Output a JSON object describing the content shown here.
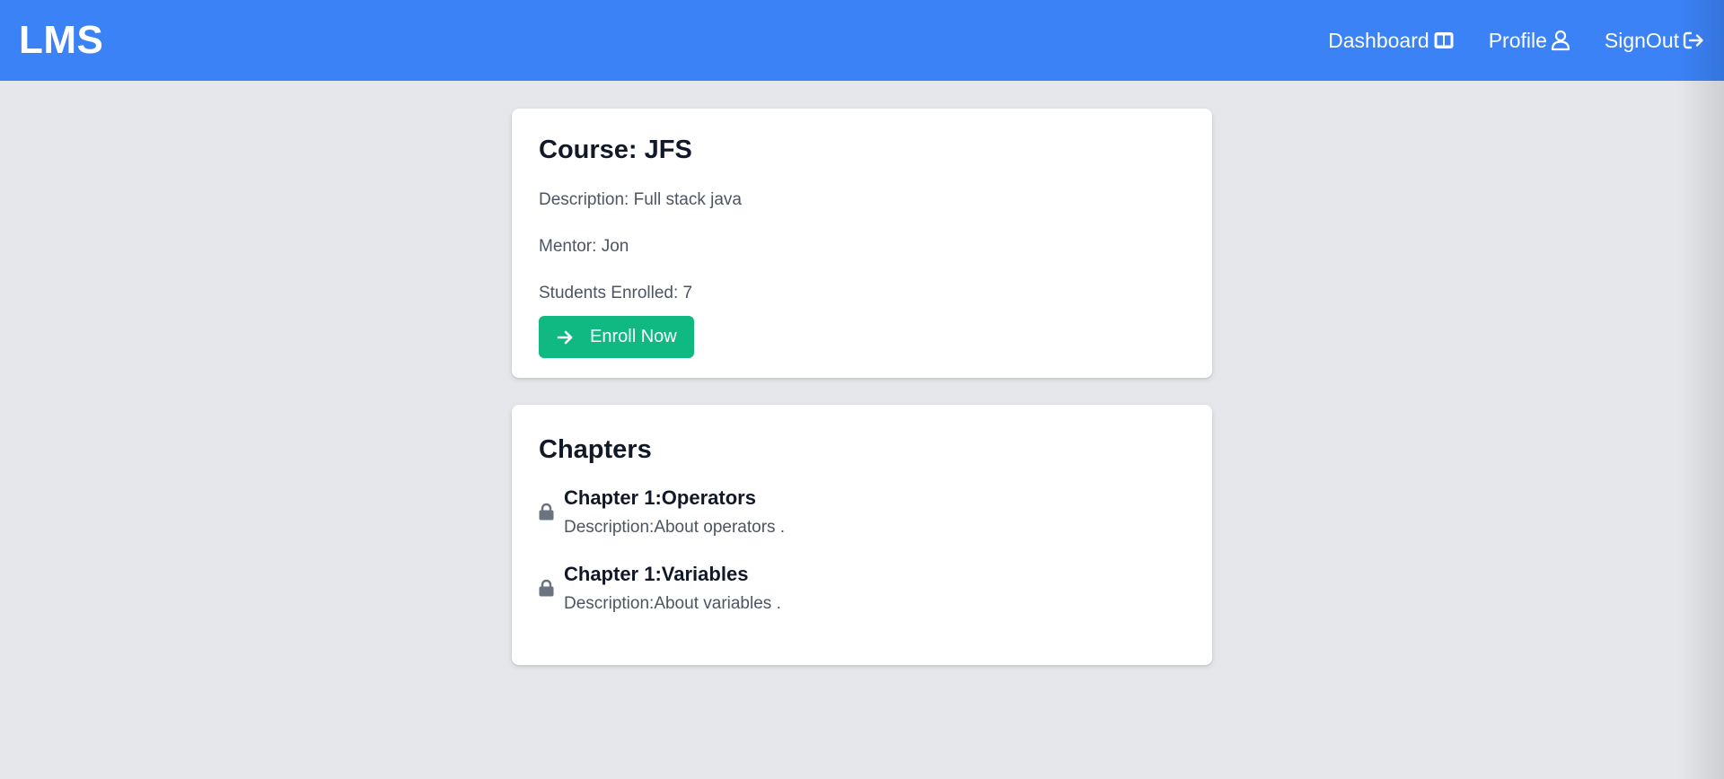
{
  "nav": {
    "logo": "LMS",
    "links": [
      {
        "label": "Dashboard",
        "icon": "columns-icon"
      },
      {
        "label": "Profile",
        "icon": "user-icon"
      },
      {
        "label": "SignOut",
        "icon": "sign-out-icon"
      }
    ]
  },
  "course": {
    "title": "Course: JFS",
    "description": "Description: Full stack java",
    "mentor": "Mentor: Jon",
    "students": "Students Enrolled: 7",
    "enroll_label": "Enroll Now"
  },
  "chapters": {
    "title": "Chapters",
    "items": [
      {
        "title": "Chapter 1:Operators",
        "description": "Description:About operators ."
      },
      {
        "title": "Chapter 1:Variables",
        "description": "Description:About variables ."
      }
    ]
  },
  "colors": {
    "navbar": "#3b82f6",
    "background": "#e5e7eb",
    "enroll_button": "#10b981",
    "lock_icon": "#6b7280"
  }
}
